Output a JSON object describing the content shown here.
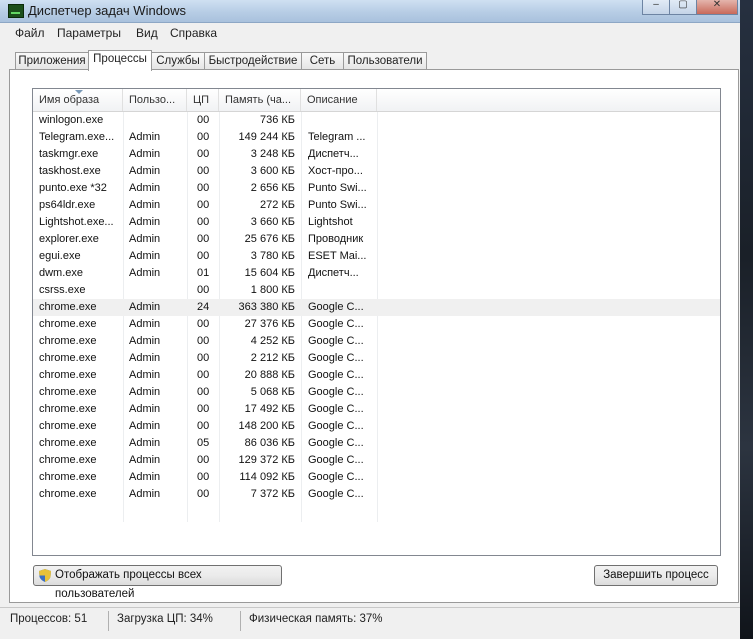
{
  "window": {
    "title": "Диспетчер задач Windows"
  },
  "title_buttons": {
    "minimize": "‒",
    "maximize": "▢",
    "close": "✕"
  },
  "menu": [
    "Файл",
    "Параметры",
    "Вид",
    "Справка"
  ],
  "tabs": [
    "Приложения",
    "Процессы",
    "Службы",
    "Быстродействие",
    "Сеть",
    "Пользователи"
  ],
  "active_tab": "Процессы",
  "columns": [
    "Имя образа",
    "Пользо...",
    "ЦП",
    "Память (ча...",
    "Описание"
  ],
  "rows": [
    {
      "name": "winlogon.exe",
      "user": "",
      "cpu": "00",
      "mem": "736 КБ",
      "desc": ""
    },
    {
      "name": "Telegram.exe...",
      "user": "Admin",
      "cpu": "00",
      "mem": "149 244 КБ",
      "desc": "Telegram ..."
    },
    {
      "name": "taskmgr.exe",
      "user": "Admin",
      "cpu": "00",
      "mem": "3 248 КБ",
      "desc": "Диспетч..."
    },
    {
      "name": "taskhost.exe",
      "user": "Admin",
      "cpu": "00",
      "mem": "3 600 КБ",
      "desc": "Хост-про..."
    },
    {
      "name": "punto.exe *32",
      "user": "Admin",
      "cpu": "00",
      "mem": "2 656 КБ",
      "desc": "Punto Swi..."
    },
    {
      "name": "ps64ldr.exe",
      "user": "Admin",
      "cpu": "00",
      "mem": "272 КБ",
      "desc": "Punto Swi..."
    },
    {
      "name": "Lightshot.exe...",
      "user": "Admin",
      "cpu": "00",
      "mem": "3 660 КБ",
      "desc": "Lightshot"
    },
    {
      "name": "explorer.exe",
      "user": "Admin",
      "cpu": "00",
      "mem": "25 676 КБ",
      "desc": "Проводник"
    },
    {
      "name": "egui.exe",
      "user": "Admin",
      "cpu": "00",
      "mem": "3 780 КБ",
      "desc": "ESET Mai..."
    },
    {
      "name": "dwm.exe",
      "user": "Admin",
      "cpu": "01",
      "mem": "15 604 КБ",
      "desc": "Диспетч..."
    },
    {
      "name": "csrss.exe",
      "user": "",
      "cpu": "00",
      "mem": "1 800 КБ",
      "desc": ""
    },
    {
      "name": "chrome.exe",
      "user": "Admin",
      "cpu": "24",
      "mem": "363 380 КБ",
      "desc": "Google C...",
      "selected": true
    },
    {
      "name": "chrome.exe",
      "user": "Admin",
      "cpu": "00",
      "mem": "27 376 КБ",
      "desc": "Google C..."
    },
    {
      "name": "chrome.exe",
      "user": "Admin",
      "cpu": "00",
      "mem": "4 252 КБ",
      "desc": "Google C..."
    },
    {
      "name": "chrome.exe",
      "user": "Admin",
      "cpu": "00",
      "mem": "2 212 КБ",
      "desc": "Google C..."
    },
    {
      "name": "chrome.exe",
      "user": "Admin",
      "cpu": "00",
      "mem": "20 888 КБ",
      "desc": "Google C..."
    },
    {
      "name": "chrome.exe",
      "user": "Admin",
      "cpu": "00",
      "mem": "5 068 КБ",
      "desc": "Google C..."
    },
    {
      "name": "chrome.exe",
      "user": "Admin",
      "cpu": "00",
      "mem": "17 492 КБ",
      "desc": "Google C..."
    },
    {
      "name": "chrome.exe",
      "user": "Admin",
      "cpu": "00",
      "mem": "148 200 КБ",
      "desc": "Google C..."
    },
    {
      "name": "chrome.exe",
      "user": "Admin",
      "cpu": "05",
      "mem": "86 036 КБ",
      "desc": "Google C..."
    },
    {
      "name": "chrome.exe",
      "user": "Admin",
      "cpu": "00",
      "mem": "129 372 КБ",
      "desc": "Google C..."
    },
    {
      "name": "chrome.exe",
      "user": "Admin",
      "cpu": "00",
      "mem": "114 092 КБ",
      "desc": "Google C..."
    },
    {
      "name": "chrome.exe",
      "user": "Admin",
      "cpu": "00",
      "mem": "7 372 КБ",
      "desc": "Google C..."
    }
  ],
  "buttons": {
    "show_all": "Отображать процессы всех пользователей",
    "end_process": "Завершить процесс"
  },
  "status": {
    "processes": "Процессов: 51",
    "cpu": "Загрузка ЦП: 34%",
    "memory": "Физическая память: 37%"
  },
  "colors": {
    "titlebar": "#b7cde5",
    "window": "#f0f0f0",
    "selected_row": "#f0f0f0"
  }
}
